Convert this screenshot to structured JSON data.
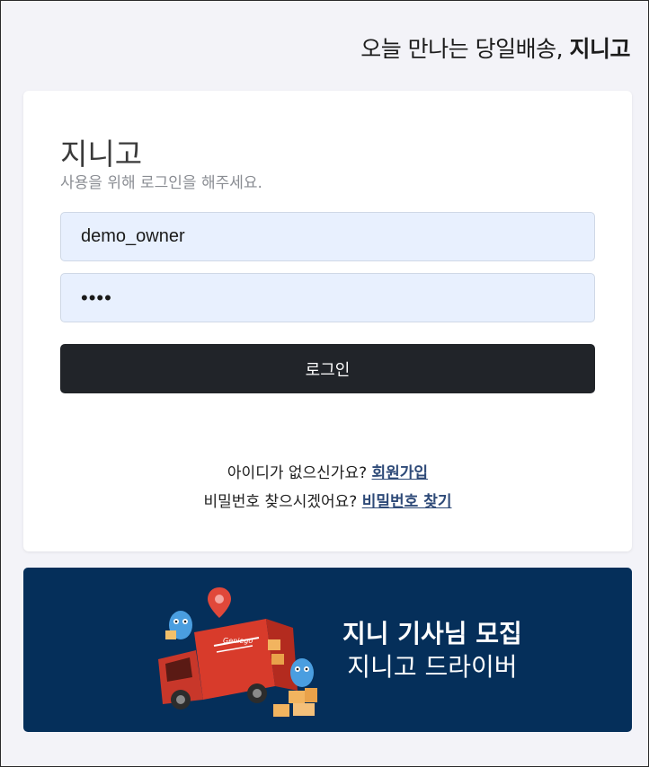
{
  "header": {
    "tagline_regular": "오늘 만나는 당일배송,",
    "tagline_bold": "지니고"
  },
  "login": {
    "brand": "지니고",
    "subtitle": "사용을 위해 로그인을 해주세요.",
    "username_value": "demo_owner",
    "password_value": "••••",
    "login_label": "로그인",
    "signup_prompt": "아이디가 없으신가요?",
    "signup_link": "회원가입",
    "find_pw_prompt": "비밀번호 찾으시겠어요?",
    "find_pw_link": "비밀번호 찾기"
  },
  "banner": {
    "line1": "지니 기사님 모집",
    "line2": "지니고 드라이버",
    "truck_logo_text": "Geniego"
  },
  "colors": {
    "page_bg": "#f3f3f8",
    "button_bg": "#212429",
    "input_bg": "#e8f0fe",
    "link": "#2e4a78",
    "banner_bg": "#052f5a",
    "truck_red": "#d83b2b"
  }
}
